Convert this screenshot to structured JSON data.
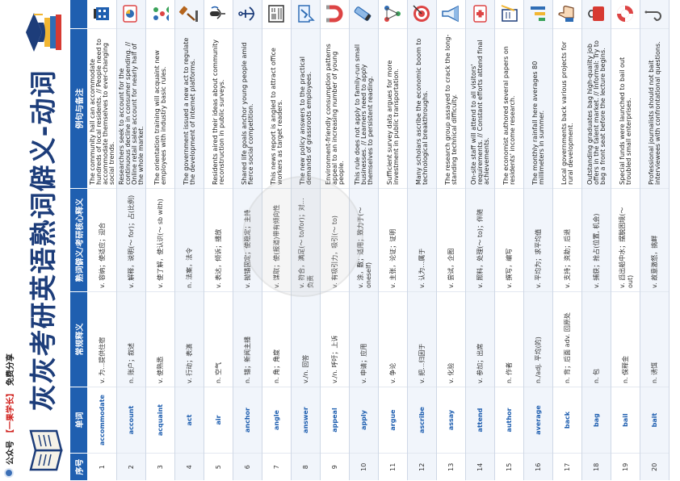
{
  "header": {
    "account_prefix": "公众号",
    "account_name": "【一果学长】",
    "account_suffix": "免费分享",
    "title": "灰灰考研英语熟词僻义-动词"
  },
  "table": {
    "headers": [
      "序号",
      "单词",
      "常规释义",
      "熟词僻义/考研核心释义",
      "例句与备注",
      ""
    ],
    "rows": [
      {
        "num": "1",
        "word": "accommodate",
        "common": "v. 为…提供住宿",
        "exam": "v. 容纳；使适应；迎合",
        "example": "The community hall can accommodate hundreds of local residents. // People need to accommodate themselves to ever-changing social trends.",
        "icon": "hotel-icon"
      },
      {
        "num": "2",
        "word": "account",
        "common": "n. 账户；叙述",
        "exam": "v. 解释，说明(～ for)；占(比例)",
        "example": "Researchers seek to account for the continuous decline in consumer spending. // Online retail sales account for nearly half of the whole market.",
        "icon": "pie-chart-icon"
      },
      {
        "num": "3",
        "word": "acquaint",
        "common": "v. 使熟悉",
        "exam": "v. 使了解，使认识(～ sb with)",
        "example": "The orientation training will acquaint new employees with industry basic rules.",
        "icon": "people-icon"
      },
      {
        "num": "4",
        "word": "act",
        "common": "v. 行动；表演",
        "exam": "n. 法案，法令",
        "example": "The government issued a new act to regulate the development of internet platforms.",
        "icon": "gavel-icon"
      },
      {
        "num": "5",
        "word": "air",
        "common": "n. 空气",
        "exam": "v. 表达，倾诉；播放",
        "example": "Residents aired their ideas about community reconstruction in public surveys.",
        "icon": "microphone-icon"
      },
      {
        "num": "6",
        "word": "anchor",
        "common": "n. 锚；新闻主播",
        "exam": "v. 抛锚固定；使稳定；主持",
        "example": "Shared life goals anchor young people amid fierce social competition.",
        "icon": "anchor-icon"
      },
      {
        "num": "7",
        "word": "angle",
        "common": "n. 角；角度",
        "exam": "v. 谋取；使(报道)带有倾向性",
        "example": "This news report is angled to attract office workers as target readers.",
        "icon": "newspaper-icon"
      },
      {
        "num": "8",
        "word": "answer",
        "common": "v./n. 回答",
        "exam": "v. 符合，满足(～ to/for)；对…负责",
        "example": "The new policy answers to the practical demands of grassroots employees.",
        "icon": "check-bubble-icon"
      },
      {
        "num": "9",
        "word": "appeal",
        "common": "v./n. 呼吁；上诉",
        "exam": "v. 有吸引力，吸引(～ to)",
        "example": "Environment-friendly consumption patterns appeal to an increasing number of young people.",
        "icon": "magnet-icon"
      },
      {
        "num": "10",
        "word": "apply",
        "common": "v. 申请；应用",
        "exam": "v. 涂，敷；适用；致力于(～ oneself)",
        "example": "This rule does not apply to family-run small businesses. // Learners need to apply themselves to persistent reading.",
        "icon": "tube-icon"
      },
      {
        "num": "11",
        "word": "argue",
        "common": "v. 争论",
        "exam": "v. 主张，论证；证明",
        "example": "Sufficient survey data argues for more investment in public transportation.",
        "icon": "network-icon"
      },
      {
        "num": "12",
        "word": "ascribe",
        "common": "v. 把…归因于",
        "exam": "v. 认为…属于",
        "example": "Many scholars ascribe the economic boom to technological breakthroughs.",
        "icon": "target-icon"
      },
      {
        "num": "13",
        "word": "assay",
        "common": "v. 化验",
        "exam": "v. 尝试，企图",
        "example": "The research group assayed to crack the long-standing technical difficulty.",
        "icon": "flask-icon"
      },
      {
        "num": "14",
        "word": "attend",
        "common": "v. 参加；出席",
        "exam": "v. 照料，处理(～ to)；伴随",
        "example": "On-site staff will attend to all visitors' requirements. // Constant efforts attend final achievements.",
        "icon": "first-aid-icon"
      },
      {
        "num": "15",
        "word": "author",
        "common": "n. 作者",
        "exam": "v. 撰写，编写",
        "example": "The economist authored several papers on residents' income research.",
        "icon": "book-writing-icon"
      },
      {
        "num": "16",
        "word": "average",
        "common": "n./adj. 平均(的)",
        "exam": "v. 平均为；求平均值",
        "example": "The monthly rainfall here averages 80 millimeters in summer.",
        "icon": "bar-chart-icon"
      },
      {
        "num": "17",
        "word": "back",
        "common": "n. 背；后面 adv. 回原处",
        "exam": "v. 支持；资助；后退",
        "example": "Local governments back various projects for rural development.",
        "icon": "thumbs-up-icon"
      },
      {
        "num": "18",
        "word": "bag",
        "common": "n. 包",
        "exam": "v. 捕获；抢占(位置, 机会)",
        "example": "Outstanding graduates bag high-quality job offers in the talent market. // Informal: Try to bag a front seat before the lecture begins.",
        "icon": "bag-icon"
      },
      {
        "num": "19",
        "word": "bail",
        "common": "n. 保释金",
        "exam": "v. 舀出船中水；摆脱困境(～ out)",
        "example": "Special funds were launched to bail out troubled small enterprises.",
        "icon": "lifebuoy-icon"
      },
      {
        "num": "20",
        "word": "bait",
        "common": "n. 诱饵",
        "exam": "v. 故意激怒，挑衅",
        "example": "Professional journalists should not bait interviewees with confrontational questions.",
        "icon": "fishhook-icon"
      }
    ]
  },
  "colors": {
    "header_blue": "#1f5fb0",
    "title_navy": "#1d3d7a",
    "account_red": "#d0201c"
  }
}
